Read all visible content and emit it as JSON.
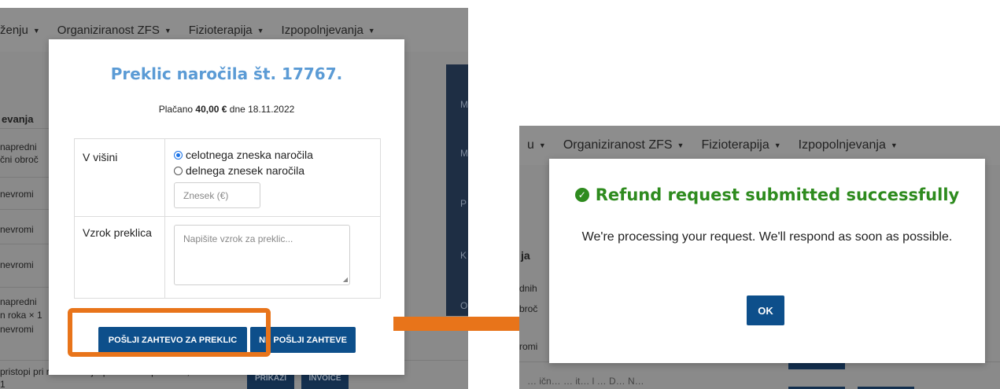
{
  "left_screen": {
    "nav": [
      "ženju",
      "Organiziranost ZFS",
      "Fizioterapija",
      "Izpopolnjevanja"
    ],
    "bg_column_header": "evanja",
    "bg_rows": [
      "napredni",
      "čni obroč",
      "nevromi",
      "nevromi",
      "nevromi",
      "napredni",
      "n roka × 1",
      "nevromi",
      "pristopi pri rehabilitaciji športnika ali pacienta,",
      "1"
    ],
    "bg_side_letters": [
      "M",
      "M",
      "P",
      "K",
      "O"
    ],
    "bg_buttons": [
      "PRIKAŽI",
      "INVOICE"
    ],
    "modal": {
      "title": "Preklic naročila št. 17767.",
      "paid_prefix": "Plačano ",
      "paid_amount": "40,00 €",
      "paid_suffix": " dne 18.11.2022",
      "amount_label": "V višini",
      "option_full": "celotnega zneska naročila",
      "option_partial": "delnega znesek naročila",
      "amount_placeholder": "Znesek (€)",
      "reason_label": "Vzrok preklica",
      "reason_placeholder": "Napišite vzrok za preklic...",
      "submit_label": "POŠLJI ZAHTEVO ZA PREKLIC",
      "cancel_label": "NE POŠLJI ZAHTEVE"
    }
  },
  "right_screen": {
    "nav": [
      "u",
      "Organiziranost ZFS",
      "Fizioterapija",
      "Izpopolnjevanja"
    ],
    "bg_column_header": "ja",
    "bg_rows": [
      "dnih",
      "broč",
      "romi"
    ],
    "bg_bottom_text": "… ičn… … it… l … D… N…",
    "modal": {
      "title": "Refund request submitted successfully",
      "message": "We're processing your request. We'll respond as soon as possible.",
      "ok_label": "OK"
    }
  },
  "colors": {
    "title_blue": "#5b9bd5",
    "primary_button": "#0d4f8b",
    "success_green": "#2e8b1e",
    "highlight_orange": "#e8741a"
  }
}
